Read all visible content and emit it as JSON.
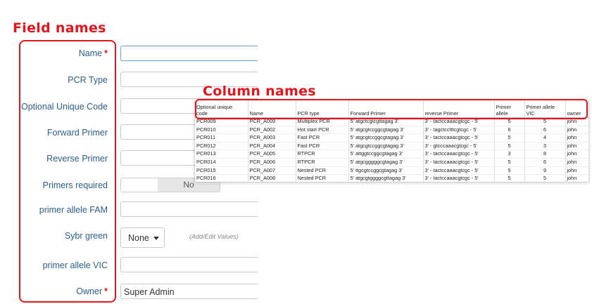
{
  "annotations": {
    "field_names": "Field names",
    "column_names": "Column names"
  },
  "form": {
    "name_label": "Name",
    "required_mark": "*",
    "pcr_type_label": "PCR Type",
    "unique_code_label": "Optional Unique Code",
    "forward_primer_label": "Forward Primer",
    "reverse_primer_label": "Reverse Primer",
    "primers_required_label": "Primers required",
    "primers_required_value": "No",
    "fam_label": "primer allele FAM",
    "sybr_label": "Sybr green",
    "sybr_value": "None",
    "sybr_helper": "(Add/Edit Values)",
    "vic_label": "primer allele VIC",
    "owner_label": "Owner",
    "owner_value": "Super Admin"
  },
  "table": {
    "headers": {
      "code": [
        "Optional unique",
        "code"
      ],
      "name": "Name",
      "pcr_type": "PCR type",
      "forward": "Forward Primer",
      "reverse": "reverse Primer",
      "allele": [
        "Primer",
        "allele"
      ],
      "vic": [
        "Primer allele",
        "VIC"
      ],
      "owner": "owner"
    },
    "rows": [
      {
        "code": "PCR009",
        "name": "PCR_A009",
        "type": "Multiplex PCR",
        "fwd": "5' atgctcgtcgttagag 3'",
        "rev": "3' - tactccaaacgtcgc - 5'",
        "allele": "5",
        "vic": "5",
        "owner": "john"
      },
      {
        "code": "PCR010",
        "name": "PCR_A002",
        "type": "Hot start PCR",
        "fwd": "5' atgcgtccggcgtagag 3'",
        "rev": "3' - tagctcctttcgtcgc - 5'",
        "allele": "6",
        "vic": "6",
        "owner": "john"
      },
      {
        "code": "PCR011",
        "name": "PCR_A003",
        "type": "Fast PCR",
        "fwd": "5' atgcgtccggcgtagag 3'",
        "rev": "3' - tactccaaacgtcgc - 5'",
        "allele": "5",
        "vic": "4",
        "owner": "john"
      },
      {
        "code": "PCR012",
        "name": "PCR_A004",
        "type": "Fast PCR",
        "fwd": "5' atgcgtccggcgtagag 3'",
        "rev": "3' - gtcccaaacgtcgc - 5'",
        "allele": "5",
        "vic": "3",
        "owner": "john"
      },
      {
        "code": "PCR013",
        "name": "PCR_A005",
        "type": "RTPCR",
        "fwd": "5' attggtccggcgtagag 3'",
        "rev": "3' - tactccaaacgtcgc - 5'",
        "allele": "3",
        "vic": "8",
        "owner": "john"
      },
      {
        "code": "PCR014",
        "name": "PCR_A006",
        "type": "RTPCR",
        "fwd": "5' atgcgggggcgtagag 3'",
        "rev": "3' - tactccaaacgtcgc - 5'",
        "allele": "5",
        "vic": "6",
        "owner": "john"
      },
      {
        "code": "PCR015",
        "name": "PCR_A007",
        "type": "Nested PCR",
        "fwd": "5' ttgcgtccggcgtagag 3'",
        "rev": "3' - tactccaaacgtcgc - 5'",
        "allele": "5",
        "vic": "9",
        "owner": "john"
      },
      {
        "code": "PCR016",
        "name": "PCR_A008",
        "type": "Nested PCR",
        "fwd": "5' atgcgtggggcgttagag 3'",
        "rev": "3' - tactccaaacgtcgc - 5'",
        "allele": "5",
        "vic": "5",
        "owner": "john"
      }
    ]
  },
  "colors": {
    "annotation_red": "#e8141b",
    "label_blue": "#2b5e8c"
  }
}
